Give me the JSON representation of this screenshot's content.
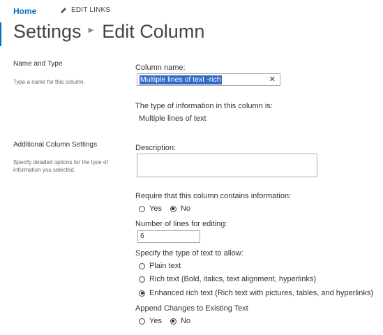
{
  "topnav": {
    "home_label": "Home",
    "edit_links_label": "EDIT LINKS"
  },
  "header": {
    "crumb_settings": "Settings",
    "crumb_edit_column": "Edit Column"
  },
  "sections": {
    "name_type": {
      "title": "Name and Type",
      "description": "Type a name for this column.",
      "column_name_label": "Column name:",
      "column_name_value": "Multiple lines of text -rich",
      "type_info_label": "The type of information in this column is:",
      "type_info_value": "Multiple lines of text"
    },
    "additional": {
      "title": "Additional Column Settings",
      "description_line1": "Specify detailed options for the type of",
      "description_line2": "information you selected.",
      "description_label": "Description:",
      "description_value": "",
      "require_label": "Require that this column contains information:",
      "require_options": [
        "Yes",
        "No"
      ],
      "require_selected": "No",
      "lines_label": "Number of lines for editing:",
      "lines_value": "6",
      "text_type_label": "Specify the type of text to allow:",
      "text_type_options": [
        "Plain text",
        "Rich text (Bold, italics, text alignment, hyperlinks)",
        "Enhanced rich text (Rich text with pictures, tables, and hyperlinks)"
      ],
      "text_type_selected": "Enhanced rich text (Rich text with pictures, tables, and hyperlinks)",
      "append_label": "Append Changes to Existing Text",
      "append_options": [
        "Yes",
        "No"
      ],
      "append_selected": "No"
    }
  },
  "icons": {
    "edit": "pencil-icon",
    "clear": "close-icon",
    "separator": "chevron-right-icon"
  },
  "colors": {
    "accent": "#0072c6",
    "selection": "#3169c6"
  }
}
